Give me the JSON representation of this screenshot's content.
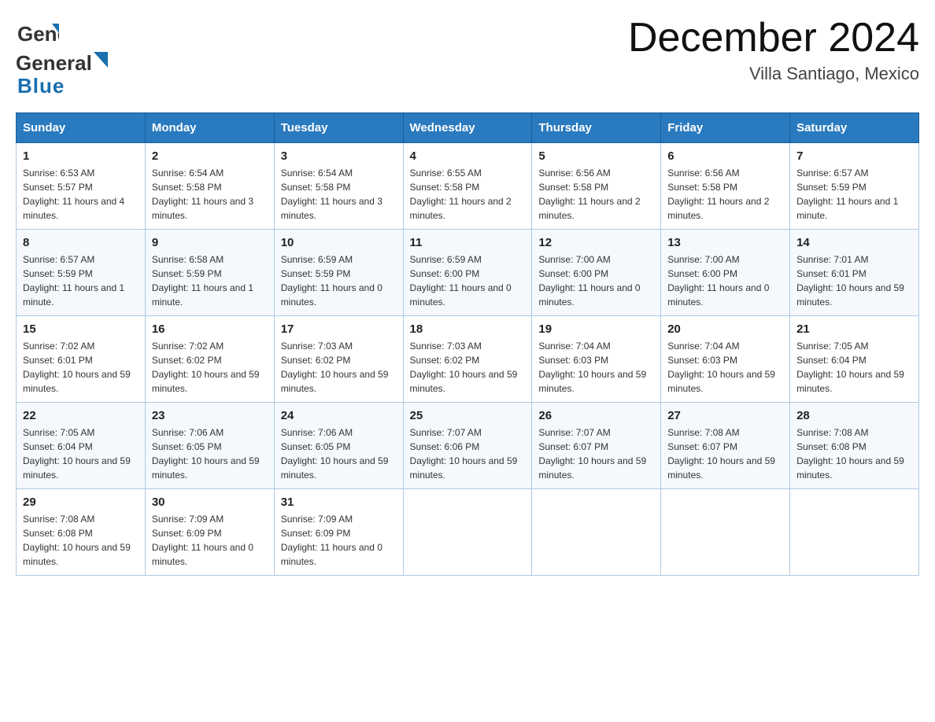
{
  "header": {
    "logo_general": "General",
    "logo_blue": "Blue",
    "month_title": "December 2024",
    "location": "Villa Santiago, Mexico"
  },
  "days_of_week": [
    "Sunday",
    "Monday",
    "Tuesday",
    "Wednesday",
    "Thursday",
    "Friday",
    "Saturday"
  ],
  "weeks": [
    [
      {
        "day": "1",
        "sunrise": "6:53 AM",
        "sunset": "5:57 PM",
        "daylight": "11 hours and 4 minutes."
      },
      {
        "day": "2",
        "sunrise": "6:54 AM",
        "sunset": "5:58 PM",
        "daylight": "11 hours and 3 minutes."
      },
      {
        "day": "3",
        "sunrise": "6:54 AM",
        "sunset": "5:58 PM",
        "daylight": "11 hours and 3 minutes."
      },
      {
        "day": "4",
        "sunrise": "6:55 AM",
        "sunset": "5:58 PM",
        "daylight": "11 hours and 2 minutes."
      },
      {
        "day": "5",
        "sunrise": "6:56 AM",
        "sunset": "5:58 PM",
        "daylight": "11 hours and 2 minutes."
      },
      {
        "day": "6",
        "sunrise": "6:56 AM",
        "sunset": "5:58 PM",
        "daylight": "11 hours and 2 minutes."
      },
      {
        "day": "7",
        "sunrise": "6:57 AM",
        "sunset": "5:59 PM",
        "daylight": "11 hours and 1 minute."
      }
    ],
    [
      {
        "day": "8",
        "sunrise": "6:57 AM",
        "sunset": "5:59 PM",
        "daylight": "11 hours and 1 minute."
      },
      {
        "day": "9",
        "sunrise": "6:58 AM",
        "sunset": "5:59 PM",
        "daylight": "11 hours and 1 minute."
      },
      {
        "day": "10",
        "sunrise": "6:59 AM",
        "sunset": "5:59 PM",
        "daylight": "11 hours and 0 minutes."
      },
      {
        "day": "11",
        "sunrise": "6:59 AM",
        "sunset": "6:00 PM",
        "daylight": "11 hours and 0 minutes."
      },
      {
        "day": "12",
        "sunrise": "7:00 AM",
        "sunset": "6:00 PM",
        "daylight": "11 hours and 0 minutes."
      },
      {
        "day": "13",
        "sunrise": "7:00 AM",
        "sunset": "6:00 PM",
        "daylight": "11 hours and 0 minutes."
      },
      {
        "day": "14",
        "sunrise": "7:01 AM",
        "sunset": "6:01 PM",
        "daylight": "10 hours and 59 minutes."
      }
    ],
    [
      {
        "day": "15",
        "sunrise": "7:02 AM",
        "sunset": "6:01 PM",
        "daylight": "10 hours and 59 minutes."
      },
      {
        "day": "16",
        "sunrise": "7:02 AM",
        "sunset": "6:02 PM",
        "daylight": "10 hours and 59 minutes."
      },
      {
        "day": "17",
        "sunrise": "7:03 AM",
        "sunset": "6:02 PM",
        "daylight": "10 hours and 59 minutes."
      },
      {
        "day": "18",
        "sunrise": "7:03 AM",
        "sunset": "6:02 PM",
        "daylight": "10 hours and 59 minutes."
      },
      {
        "day": "19",
        "sunrise": "7:04 AM",
        "sunset": "6:03 PM",
        "daylight": "10 hours and 59 minutes."
      },
      {
        "day": "20",
        "sunrise": "7:04 AM",
        "sunset": "6:03 PM",
        "daylight": "10 hours and 59 minutes."
      },
      {
        "day": "21",
        "sunrise": "7:05 AM",
        "sunset": "6:04 PM",
        "daylight": "10 hours and 59 minutes."
      }
    ],
    [
      {
        "day": "22",
        "sunrise": "7:05 AM",
        "sunset": "6:04 PM",
        "daylight": "10 hours and 59 minutes."
      },
      {
        "day": "23",
        "sunrise": "7:06 AM",
        "sunset": "6:05 PM",
        "daylight": "10 hours and 59 minutes."
      },
      {
        "day": "24",
        "sunrise": "7:06 AM",
        "sunset": "6:05 PM",
        "daylight": "10 hours and 59 minutes."
      },
      {
        "day": "25",
        "sunrise": "7:07 AM",
        "sunset": "6:06 PM",
        "daylight": "10 hours and 59 minutes."
      },
      {
        "day": "26",
        "sunrise": "7:07 AM",
        "sunset": "6:07 PM",
        "daylight": "10 hours and 59 minutes."
      },
      {
        "day": "27",
        "sunrise": "7:08 AM",
        "sunset": "6:07 PM",
        "daylight": "10 hours and 59 minutes."
      },
      {
        "day": "28",
        "sunrise": "7:08 AM",
        "sunset": "6:08 PM",
        "daylight": "10 hours and 59 minutes."
      }
    ],
    [
      {
        "day": "29",
        "sunrise": "7:08 AM",
        "sunset": "6:08 PM",
        "daylight": "10 hours and 59 minutes."
      },
      {
        "day": "30",
        "sunrise": "7:09 AM",
        "sunset": "6:09 PM",
        "daylight": "11 hours and 0 minutes."
      },
      {
        "day": "31",
        "sunrise": "7:09 AM",
        "sunset": "6:09 PM",
        "daylight": "11 hours and 0 minutes."
      },
      null,
      null,
      null,
      null
    ]
  ]
}
